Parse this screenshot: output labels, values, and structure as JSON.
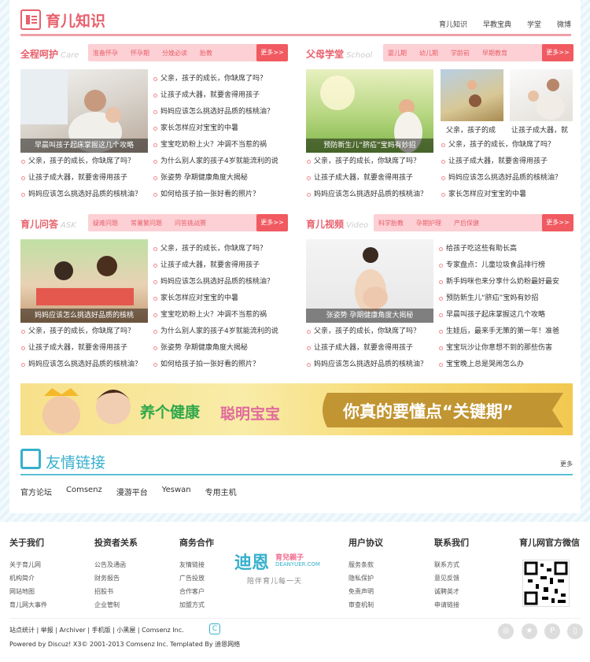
{
  "header": {
    "title": "育儿知识",
    "nav": [
      "育儿知识",
      "早教宝典",
      "学堂",
      "微博"
    ]
  },
  "sections": {
    "care": {
      "title": "全程呵护",
      "en": "Care",
      "tags": [
        "准备怀孕",
        "怀孕期",
        "分娩必读",
        "胎教"
      ],
      "more": "更多>>",
      "pic_caption": "早晨叫孩子起床掌握这几个攻略",
      "right_list": [
        "父亲，孩子的成长，你缺席了吗？",
        "让孩子成大器，就要舍得用孩子",
        "妈妈应该怎么挑选好品质的核桃油？",
        "家长怎样应对宝宝的中暑",
        "宝宝吃奶粉上火？冲调不当惹的祸",
        "为什么别人家的孩子4岁就能流利的说",
        "张姿势 孕期健康角度大揭秘",
        "如何给孩子拍一张好看的照片？"
      ],
      "left_list": [
        "父亲，孩子的成长，你缺席了吗？",
        "让孩子成大器，就要舍得用孩子",
        "妈妈应该怎么挑选好品质的核桃油？"
      ]
    },
    "school": {
      "title": "父母学堂",
      "en": "School",
      "tags": [
        "婴儿期",
        "幼儿期",
        "学龄前",
        "早期教育"
      ],
      "more": "更多>>",
      "pic_caption": "预防新生儿“脐疝”宝妈有妙招",
      "small_caps": [
        "父亲，孩子的成",
        "让孩子成大器，就"
      ],
      "left_list": [
        "父亲，孩子的成长，你缺席了吗？",
        "让孩子成大器，就要舍得用孩子",
        "妈妈应该怎么挑选好品质的核桃油？"
      ],
      "right_list": [
        "父亲，孩子的成长，你缺席了吗？",
        "让孩子成大器，就要舍得用孩子",
        "妈妈应该怎么挑选好品质的核桃油？",
        "家长怎样应对宝宝的中暑"
      ]
    },
    "ask": {
      "title": "育儿问答",
      "en": "ASK",
      "tags": [
        "疑难问题",
        "常暑繁问题",
        "问答挑战赛"
      ],
      "more": "更多>>",
      "pic_caption": "妈妈应该怎么挑选好品质的核桃",
      "right_list": [
        "父亲，孩子的成长，你缺席了吗？",
        "让孩子成大器，就要舍得用孩子",
        "妈妈应该怎么挑选好品质的核桃油？",
        "家长怎样应对宝宝的中暑",
        "宝宝吃奶粉上火？冲调不当惹的祸",
        "为什么别人家的孩子4岁就能流利的说",
        "张姿势 孕期健康角度大揭秘",
        "如何给孩子拍一张好看的照片？"
      ],
      "left_list": [
        "父亲，孩子的成长，你缺席了吗？",
        "让孩子成大器，就要舍得用孩子",
        "妈妈应该怎么挑选好品质的核桃油？"
      ]
    },
    "video": {
      "title": "育儿视频",
      "en": "Video",
      "tags": [
        "科学胎教",
        "孕期护理",
        "产后保健"
      ],
      "more": "更多>>",
      "pic_caption": "张姿势 孕期健康角度大揭秘",
      "right_list": [
        "给孩子吃这些有助长高",
        "专家盘点：儿童垃圾食品排行榜",
        "新手妈咪也来分享什么奶粉最好最安",
        "预防新生儿“脐疝”宝妈有妙招",
        "早晨叫孩子起床掌握这几个攻略",
        "生娃后，最来手无策的第一年！准爸",
        "宝宝玩沙让你意想不到的那些伤害",
        "宝宝晚上总是哭闹怎么办"
      ],
      "left_list": [
        "父亲，孩子的成长，你缺席了吗？",
        "让孩子成大器，就要舍得用孩子",
        "妈妈应该怎么挑选好品质的核桃油？"
      ]
    }
  },
  "banner": {
    "text1": "养个健康",
    "text2": "聪明宝宝",
    "text3": "你真的要懂点“关键期”"
  },
  "friends": {
    "title": "友情链接",
    "more": "更多",
    "links": [
      "官方论坛",
      "Comsenz",
      "漫游平台",
      "Yeswan",
      "专用主机"
    ]
  },
  "footer": {
    "cols": [
      {
        "h": "关于我们",
        "items": [
          "关于育儿网",
          "机构简介",
          "网站地图",
          "育儿网大事件"
        ]
      },
      {
        "h": "投资者关系",
        "items": [
          "公告及通函",
          "财务报告",
          "招股书",
          "企业管制"
        ]
      },
      {
        "h": "商务合作",
        "items": [
          "友情链接",
          "广告投放",
          "合作客户",
          "加盟方式"
        ]
      },
      {
        "h": "用户协议",
        "items": [
          "服务条款",
          "隐私保护",
          "免责声明",
          "审查机制"
        ]
      },
      {
        "h": "联系我们",
        "items": [
          "联系方式",
          "意见反馈",
          "诚聘英才",
          "申请链接"
        ]
      }
    ],
    "brand": "迪恩",
    "brand_sub": "育兒親子",
    "brand_en": "DEANYUER.COM",
    "slogan": "陪伴育儿每一天",
    "wechat": "育儿网官方微信",
    "links": "站点统计 | 举报 | Archiver | 手机版 | 小黑屋 | Comsenz Inc.",
    "powered": "Powered by Discuz! X3© 2001-2013 Comsenz Inc. Templated By 迪恩网络"
  }
}
